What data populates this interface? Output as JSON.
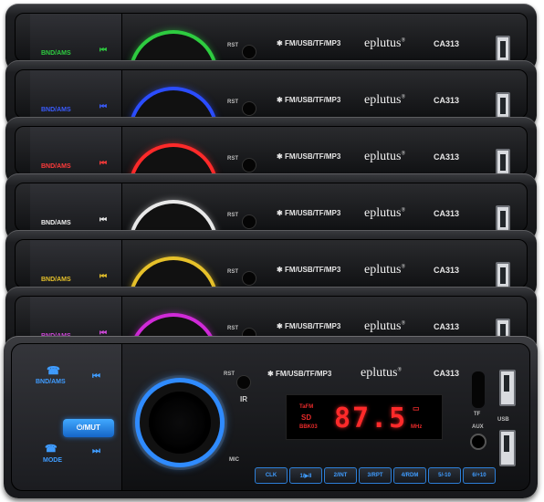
{
  "product": {
    "brand": "eplutus",
    "brand_mark": "®",
    "model": "CA313",
    "formats": "FM/USB/TF/MP3",
    "bluetooth_icon": "bluetooth-icon"
  },
  "labels": {
    "bnd_ams": "BND/AMS",
    "mute": "⏻/MUT",
    "mode": "MODE",
    "rst": "RST",
    "ir": "IR",
    "mic": "MIC",
    "tf": "TF",
    "usb": "USB",
    "aux": "AUX"
  },
  "display": {
    "frequency": "87.5",
    "unit": "MHz",
    "left_top": "TaFM",
    "left_mid": "SD",
    "left_bot": "BBK03"
  },
  "function_buttons": [
    "CLK",
    "1/▶II",
    "2/INT",
    "3/RPT",
    "4/RDM",
    "5/-10",
    "6/+10"
  ],
  "variants": [
    {
      "ring_color": "#2ecc40"
    },
    {
      "ring_color": "#2b4dff"
    },
    {
      "ring_color": "#ff2a2a"
    },
    {
      "ring_color": "#e8e8e8"
    },
    {
      "ring_color": "#e6c12a"
    },
    {
      "ring_color": "#d02ad8"
    },
    {
      "ring_color": "#2f8bff"
    }
  ]
}
